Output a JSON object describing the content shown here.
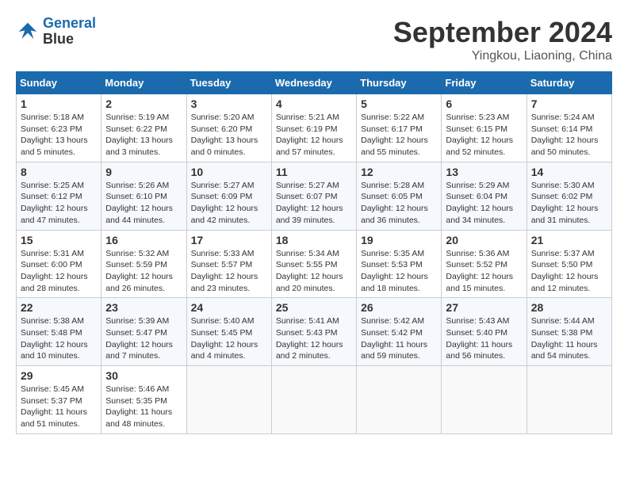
{
  "header": {
    "logo_line1": "General",
    "logo_line2": "Blue",
    "month": "September 2024",
    "location": "Yingkou, Liaoning, China"
  },
  "days_of_week": [
    "Sunday",
    "Monday",
    "Tuesday",
    "Wednesday",
    "Thursday",
    "Friday",
    "Saturday"
  ],
  "weeks": [
    [
      {
        "day": "1",
        "info": "Sunrise: 5:18 AM\nSunset: 6:23 PM\nDaylight: 13 hours\nand 5 minutes."
      },
      {
        "day": "2",
        "info": "Sunrise: 5:19 AM\nSunset: 6:22 PM\nDaylight: 13 hours\nand 3 minutes."
      },
      {
        "day": "3",
        "info": "Sunrise: 5:20 AM\nSunset: 6:20 PM\nDaylight: 13 hours\nand 0 minutes."
      },
      {
        "day": "4",
        "info": "Sunrise: 5:21 AM\nSunset: 6:19 PM\nDaylight: 12 hours\nand 57 minutes."
      },
      {
        "day": "5",
        "info": "Sunrise: 5:22 AM\nSunset: 6:17 PM\nDaylight: 12 hours\nand 55 minutes."
      },
      {
        "day": "6",
        "info": "Sunrise: 5:23 AM\nSunset: 6:15 PM\nDaylight: 12 hours\nand 52 minutes."
      },
      {
        "day": "7",
        "info": "Sunrise: 5:24 AM\nSunset: 6:14 PM\nDaylight: 12 hours\nand 50 minutes."
      }
    ],
    [
      {
        "day": "8",
        "info": "Sunrise: 5:25 AM\nSunset: 6:12 PM\nDaylight: 12 hours\nand 47 minutes."
      },
      {
        "day": "9",
        "info": "Sunrise: 5:26 AM\nSunset: 6:10 PM\nDaylight: 12 hours\nand 44 minutes."
      },
      {
        "day": "10",
        "info": "Sunrise: 5:27 AM\nSunset: 6:09 PM\nDaylight: 12 hours\nand 42 minutes."
      },
      {
        "day": "11",
        "info": "Sunrise: 5:27 AM\nSunset: 6:07 PM\nDaylight: 12 hours\nand 39 minutes."
      },
      {
        "day": "12",
        "info": "Sunrise: 5:28 AM\nSunset: 6:05 PM\nDaylight: 12 hours\nand 36 minutes."
      },
      {
        "day": "13",
        "info": "Sunrise: 5:29 AM\nSunset: 6:04 PM\nDaylight: 12 hours\nand 34 minutes."
      },
      {
        "day": "14",
        "info": "Sunrise: 5:30 AM\nSunset: 6:02 PM\nDaylight: 12 hours\nand 31 minutes."
      }
    ],
    [
      {
        "day": "15",
        "info": "Sunrise: 5:31 AM\nSunset: 6:00 PM\nDaylight: 12 hours\nand 28 minutes."
      },
      {
        "day": "16",
        "info": "Sunrise: 5:32 AM\nSunset: 5:59 PM\nDaylight: 12 hours\nand 26 minutes."
      },
      {
        "day": "17",
        "info": "Sunrise: 5:33 AM\nSunset: 5:57 PM\nDaylight: 12 hours\nand 23 minutes."
      },
      {
        "day": "18",
        "info": "Sunrise: 5:34 AM\nSunset: 5:55 PM\nDaylight: 12 hours\nand 20 minutes."
      },
      {
        "day": "19",
        "info": "Sunrise: 5:35 AM\nSunset: 5:53 PM\nDaylight: 12 hours\nand 18 minutes."
      },
      {
        "day": "20",
        "info": "Sunrise: 5:36 AM\nSunset: 5:52 PM\nDaylight: 12 hours\nand 15 minutes."
      },
      {
        "day": "21",
        "info": "Sunrise: 5:37 AM\nSunset: 5:50 PM\nDaylight: 12 hours\nand 12 minutes."
      }
    ],
    [
      {
        "day": "22",
        "info": "Sunrise: 5:38 AM\nSunset: 5:48 PM\nDaylight: 12 hours\nand 10 minutes."
      },
      {
        "day": "23",
        "info": "Sunrise: 5:39 AM\nSunset: 5:47 PM\nDaylight: 12 hours\nand 7 minutes."
      },
      {
        "day": "24",
        "info": "Sunrise: 5:40 AM\nSunset: 5:45 PM\nDaylight: 12 hours\nand 4 minutes."
      },
      {
        "day": "25",
        "info": "Sunrise: 5:41 AM\nSunset: 5:43 PM\nDaylight: 12 hours\nand 2 minutes."
      },
      {
        "day": "26",
        "info": "Sunrise: 5:42 AM\nSunset: 5:42 PM\nDaylight: 11 hours\nand 59 minutes."
      },
      {
        "day": "27",
        "info": "Sunrise: 5:43 AM\nSunset: 5:40 PM\nDaylight: 11 hours\nand 56 minutes."
      },
      {
        "day": "28",
        "info": "Sunrise: 5:44 AM\nSunset: 5:38 PM\nDaylight: 11 hours\nand 54 minutes."
      }
    ],
    [
      {
        "day": "29",
        "info": "Sunrise: 5:45 AM\nSunset: 5:37 PM\nDaylight: 11 hours\nand 51 minutes."
      },
      {
        "day": "30",
        "info": "Sunrise: 5:46 AM\nSunset: 5:35 PM\nDaylight: 11 hours\nand 48 minutes."
      },
      null,
      null,
      null,
      null,
      null
    ]
  ]
}
